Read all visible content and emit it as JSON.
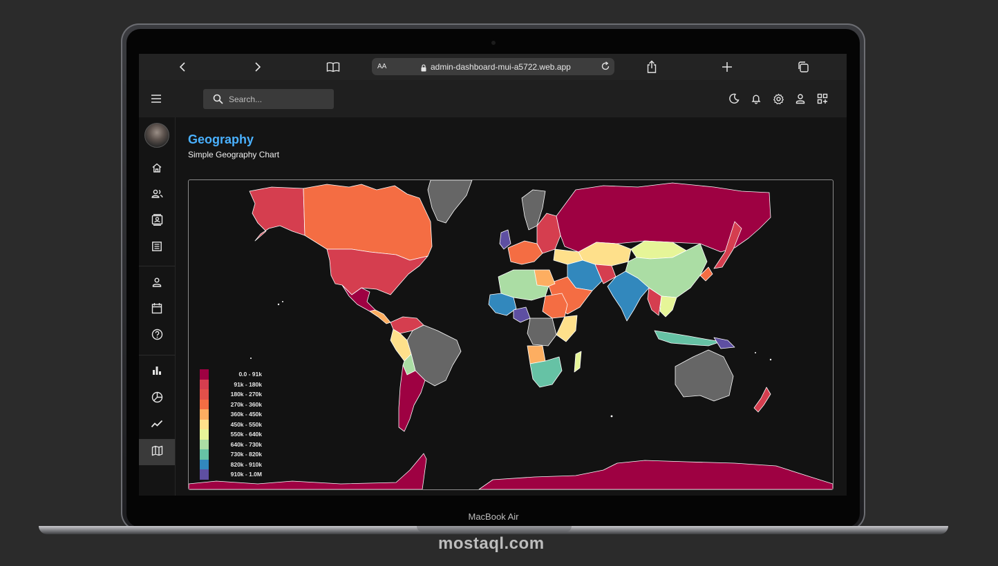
{
  "device": {
    "label": "MacBook Air"
  },
  "watermark": {
    "text": "mostaql.com"
  },
  "browser": {
    "text_size_label": "AA",
    "url": "admin-dashboard-mui-a5722.web.app"
  },
  "topbar": {
    "search_placeholder": "Search..."
  },
  "sidebar": {
    "items": [
      {
        "icon": "home-icon"
      },
      {
        "icon": "team-icon"
      },
      {
        "icon": "contacts-icon"
      },
      {
        "icon": "invoices-icon"
      },
      {
        "icon": "profile-icon"
      },
      {
        "icon": "calendar-icon"
      },
      {
        "icon": "help-icon"
      },
      {
        "icon": "bar-chart-icon"
      },
      {
        "icon": "pie-chart-icon"
      },
      {
        "icon": "line-chart-icon"
      },
      {
        "icon": "map-icon",
        "active": true
      }
    ]
  },
  "page": {
    "title": "Geography",
    "subtitle": "Simple Geography Chart",
    "accent_color": "#4ab1ff"
  },
  "chart_data": {
    "type": "choropleth",
    "legend_position": "bottom-left",
    "legend": [
      {
        "label": "0.0 - 91k",
        "color": "#9e0142"
      },
      {
        "label": "91k - 180k",
        "color": "#d53e4f"
      },
      {
        "label": "180k - 270k",
        "color": "#e2504a"
      },
      {
        "label": "270k - 360k",
        "color": "#f46d43"
      },
      {
        "label": "360k - 450k",
        "color": "#fdae61"
      },
      {
        "label": "450k - 550k",
        "color": "#fee08b"
      },
      {
        "label": "550k - 640k",
        "color": "#e6f598"
      },
      {
        "label": "640k - 730k",
        "color": "#abdda4"
      },
      {
        "label": "730k - 820k",
        "color": "#66c2a5"
      },
      {
        "label": "820k - 910k",
        "color": "#3288bd"
      },
      {
        "label": "910k - 1.0M",
        "color": "#5e4fa2"
      }
    ],
    "no_data_color": "#666666"
  }
}
